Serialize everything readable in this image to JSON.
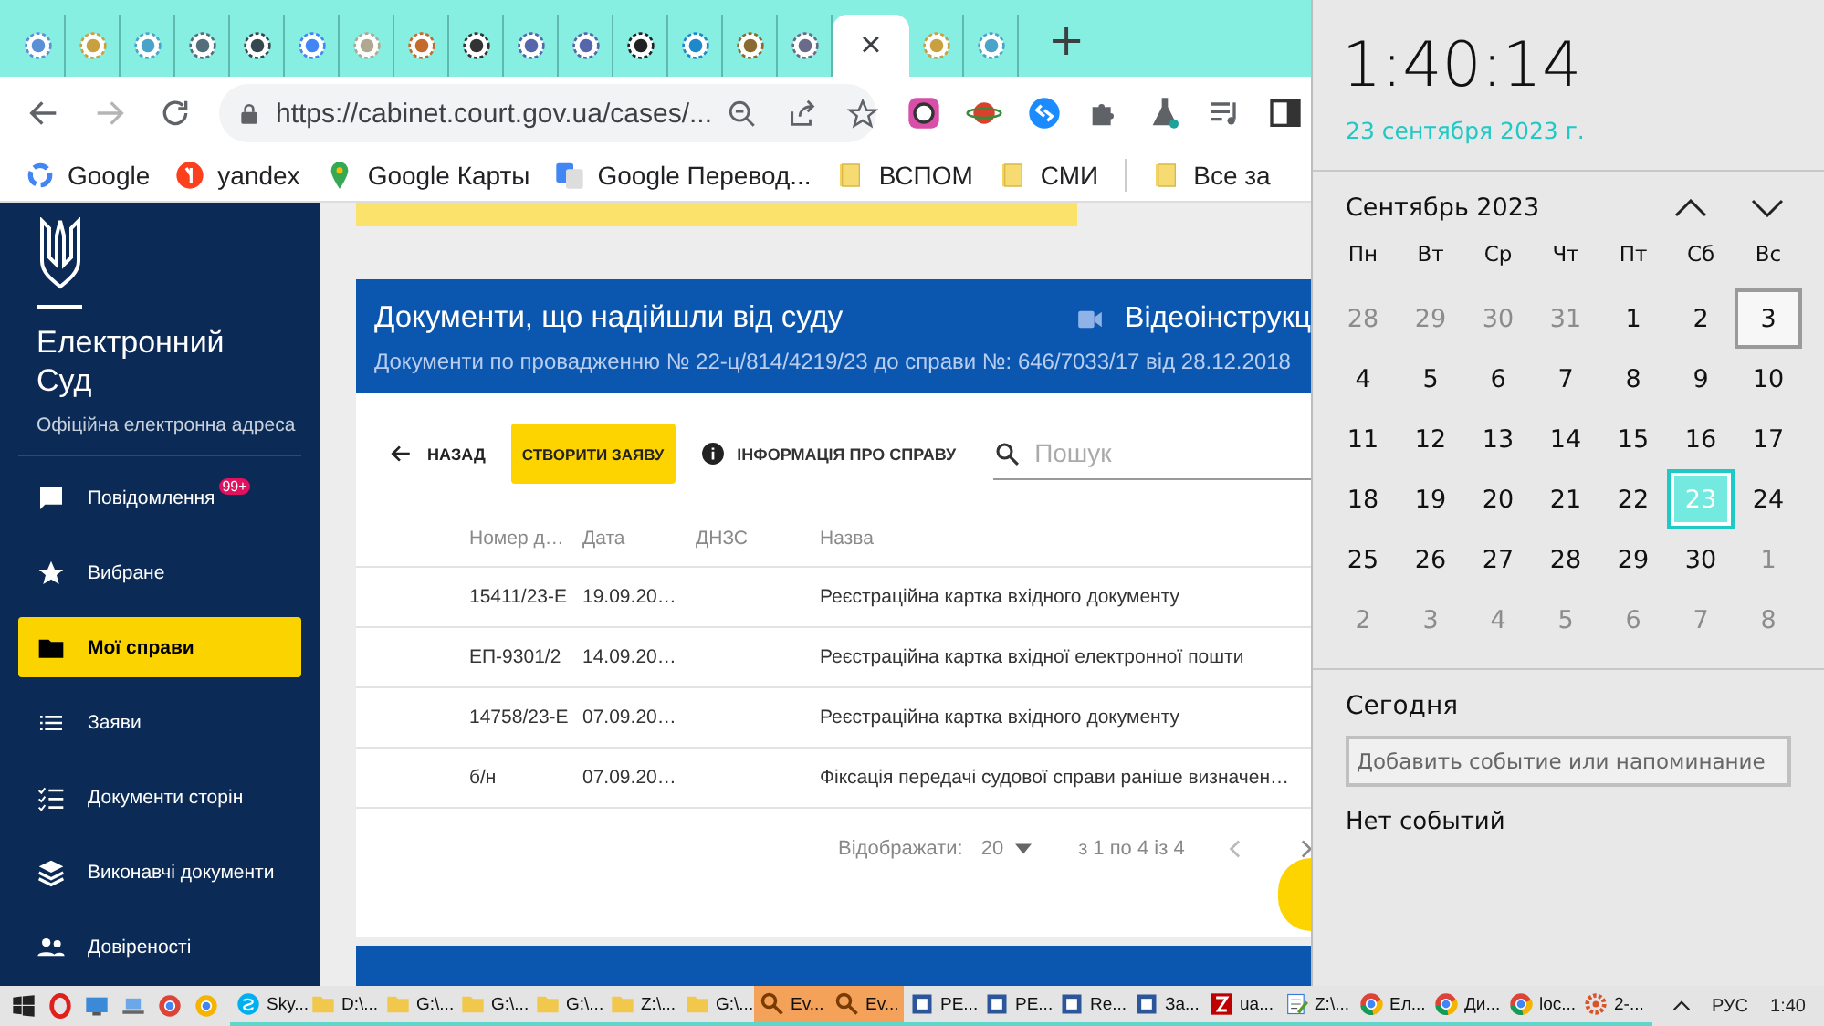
{
  "browser": {
    "tabs": [
      {
        "selected": false
      },
      {
        "selected": false
      },
      {
        "selected": false
      },
      {
        "selected": false
      },
      {
        "selected": false
      },
      {
        "selected": false
      },
      {
        "selected": false
      },
      {
        "selected": false
      },
      {
        "selected": false
      },
      {
        "selected": false
      },
      {
        "selected": false
      },
      {
        "selected": false
      },
      {
        "selected": false
      },
      {
        "selected": false
      },
      {
        "selected": false
      },
      {
        "selected": true
      },
      {
        "selected": false
      },
      {
        "selected": false
      }
    ],
    "tab_close": "×",
    "new_tab": "+",
    "nav_buttons": [
      {
        "kind": "back",
        "disabled": false
      },
      {
        "kind": "forward",
        "disabled": true
      },
      {
        "kind": "reload",
        "disabled": false
      }
    ],
    "address": {
      "url": "https://cabinet.court.gov.ua/cases/..."
    },
    "bookmarks": [
      {
        "label": "Google",
        "kind": "google"
      },
      {
        "label": "yandex",
        "kind": "yandex"
      },
      {
        "label": "Google Карты",
        "kind": "maps"
      },
      {
        "label": "Google Перевод...",
        "kind": "translate"
      },
      {
        "label": "ВСПОМ",
        "kind": "folder"
      },
      {
        "label": "СМИ",
        "kind": "folder"
      },
      {
        "label": "Все за",
        "kind": "folder"
      }
    ]
  },
  "sidebar": {
    "title": "Електронний Суд",
    "subtitle": "Офіційна електронна адреса",
    "nav": [
      {
        "label": "Повідомлення",
        "kind": "messages",
        "badge": "99+",
        "selected": false
      },
      {
        "label": "Вибране",
        "kind": "star",
        "selected": false
      },
      {
        "label": "Мої справи",
        "kind": "folder",
        "selected": true
      },
      {
        "label": "Заяви",
        "kind": "list",
        "selected": false
      },
      {
        "label": "Документи сторін",
        "kind": "checklist",
        "selected": false
      },
      {
        "label": "Виконавчі документи",
        "kind": "layers",
        "selected": false
      },
      {
        "label": "Довіреності",
        "kind": "people",
        "selected": false
      }
    ]
  },
  "case_card": {
    "title": "Документи, що надійшли від суду",
    "video_link": "Відеоінструкц",
    "subtitle": "Документи по провадженню № 22-ц/814/4219/23 до справи №: 646/7033/17 від 28.12.2018",
    "back": "НАЗАД",
    "create": "СТВОРИТИ ЗАЯВУ",
    "info": "ІНФОРМАЦІЯ ПРО СПРАВУ",
    "search": {
      "placeholder": "Пошук"
    },
    "columns": [
      "Номер д…",
      "Дата",
      "ДНЗС",
      "Назва"
    ],
    "rows": [
      [
        "15411/23-Е",
        "19.09.20…",
        "",
        "Реєстраційна картка вхідного документу"
      ],
      [
        "ЕП-9301/2",
        "14.09.20…",
        "",
        "Реєстраційна картка вхідної електронної пошти"
      ],
      [
        "14758/23-Е",
        "07.09.20…",
        "",
        "Реєстраційна картка вхідного документу"
      ],
      [
        "б/н",
        "07.09.20…",
        "",
        "Фіксація передачі судової справи раніше визначен…"
      ]
    ],
    "pagination": {
      "label": "Відображати:",
      "per_page": "20",
      "range": "з 1 по 4 із 4"
    }
  },
  "calendar": {
    "time": "1:40:14",
    "date": "23 сентября 2023 г.",
    "month": "Сентябрь 2023",
    "weekdays": [
      "Пн",
      "Вт",
      "Ср",
      "Чт",
      "Пт",
      "Сб",
      "Вс"
    ],
    "days": [
      {
        "label": "28",
        "in_month": false,
        "selected": false,
        "focused": false
      },
      {
        "label": "29",
        "in_month": false,
        "selected": false,
        "focused": false
      },
      {
        "label": "30",
        "in_month": false,
        "selected": false,
        "focused": false
      },
      {
        "label": "31",
        "in_month": false,
        "selected": false,
        "focused": false
      },
      {
        "label": "1",
        "in_month": true,
        "selected": false,
        "focused": false
      },
      {
        "label": "2",
        "in_month": true,
        "selected": false,
        "focused": false
      },
      {
        "label": "3",
        "in_month": true,
        "selected": false,
        "focused": true
      },
      {
        "label": "4",
        "in_month": true,
        "selected": false,
        "focused": false
      },
      {
        "label": "5",
        "in_month": true,
        "selected": false,
        "focused": false
      },
      {
        "label": "6",
        "in_month": true,
        "selected": false,
        "focused": false
      },
      {
        "label": "7",
        "in_month": true,
        "selected": false,
        "focused": false
      },
      {
        "label": "8",
        "in_month": true,
        "selected": false,
        "focused": false
      },
      {
        "label": "9",
        "in_month": true,
        "selected": false,
        "focused": false
      },
      {
        "label": "10",
        "in_month": true,
        "selected": false,
        "focused": false
      },
      {
        "label": "11",
        "in_month": true,
        "selected": false,
        "focused": false
      },
      {
        "label": "12",
        "in_month": true,
        "selected": false,
        "focused": false
      },
      {
        "label": "13",
        "in_month": true,
        "selected": false,
        "focused": false
      },
      {
        "label": "14",
        "in_month": true,
        "selected": false,
        "focused": false
      },
      {
        "label": "15",
        "in_month": true,
        "selected": false,
        "focused": false
      },
      {
        "label": "16",
        "in_month": true,
        "selected": false,
        "focused": false
      },
      {
        "label": "17",
        "in_month": true,
        "selected": false,
        "focused": false
      },
      {
        "label": "18",
        "in_month": true,
        "selected": false,
        "focused": false
      },
      {
        "label": "19",
        "in_month": true,
        "selected": false,
        "focused": false
      },
      {
        "label": "20",
        "in_month": true,
        "selected": false,
        "focused": false
      },
      {
        "label": "21",
        "in_month": true,
        "selected": false,
        "focused": false
      },
      {
        "label": "22",
        "in_month": true,
        "selected": false,
        "focused": false
      },
      {
        "label": "23",
        "in_month": true,
        "selected": true,
        "focused": false
      },
      {
        "label": "24",
        "in_month": true,
        "selected": false,
        "focused": false
      },
      {
        "label": "25",
        "in_month": true,
        "selected": false,
        "focused": false
      },
      {
        "label": "26",
        "in_month": true,
        "selected": false,
        "focused": false
      },
      {
        "label": "27",
        "in_month": true,
        "selected": false,
        "focused": false
      },
      {
        "label": "28",
        "in_month": true,
        "selected": false,
        "focused": false
      },
      {
        "label": "29",
        "in_month": true,
        "selected": false,
        "focused": false
      },
      {
        "label": "30",
        "in_month": true,
        "selected": false,
        "focused": false
      },
      {
        "label": "1",
        "in_month": false,
        "selected": false,
        "focused": false
      },
      {
        "label": "2",
        "in_month": false,
        "selected": false,
        "focused": false
      },
      {
        "label": "3",
        "in_month": false,
        "selected": false,
        "focused": false
      },
      {
        "label": "4",
        "in_month": false,
        "selected": false,
        "focused": false
      },
      {
        "label": "5",
        "in_month": false,
        "selected": false,
        "focused": false
      },
      {
        "label": "6",
        "in_month": false,
        "selected": false,
        "focused": false
      },
      {
        "label": "7",
        "in_month": false,
        "selected": false,
        "focused": false
      },
      {
        "label": "8",
        "in_month": false,
        "selected": false,
        "focused": false
      }
    ],
    "today_heading": "Сегодня",
    "event_input": {
      "placeholder": "Добавить событие или напоминание"
    },
    "no_events": "Нет событий"
  },
  "taskbar": {
    "items": [
      {
        "label": "Sky...",
        "kind": "chat",
        "highlighted": false
      },
      {
        "label": "D:\\...",
        "kind": "folder",
        "highlighted": false
      },
      {
        "label": "G:\\...",
        "kind": "folder",
        "highlighted": false
      },
      {
        "label": "G:\\...",
        "kind": "folder",
        "highlighted": false
      },
      {
        "label": "G:\\...",
        "kind": "folder",
        "highlighted": false
      },
      {
        "label": "Z:\\...",
        "kind": "folder",
        "highlighted": false
      },
      {
        "label": "G:\\...",
        "kind": "folder",
        "highlighted": false
      },
      {
        "label": "Ev...",
        "kind": "search",
        "highlighted": true
      },
      {
        "label": "Ev...",
        "kind": "search",
        "highlighted": true
      },
      {
        "label": "PE...",
        "kind": "doc",
        "highlighted": false
      },
      {
        "label": "PE...",
        "kind": "doc",
        "highlighted": false
      },
      {
        "label": "Re...",
        "kind": "doc",
        "highlighted": false
      },
      {
        "label": "За...",
        "kind": "doc",
        "highlighted": false
      },
      {
        "label": "ua...",
        "kind": "ftp",
        "highlighted": false
      },
      {
        "label": "Z:\\...",
        "kind": "notepad",
        "highlighted": false
      },
      {
        "label": "Ел...",
        "kind": "browser",
        "highlighted": false
      },
      {
        "label": "Ди...",
        "kind": "browser",
        "highlighted": false
      },
      {
        "label": "loc...",
        "kind": "browser",
        "highlighted": false
      },
      {
        "label": "2-...",
        "kind": "gear",
        "highlighted": false
      }
    ],
    "language": "РУС",
    "time": "1:40"
  }
}
